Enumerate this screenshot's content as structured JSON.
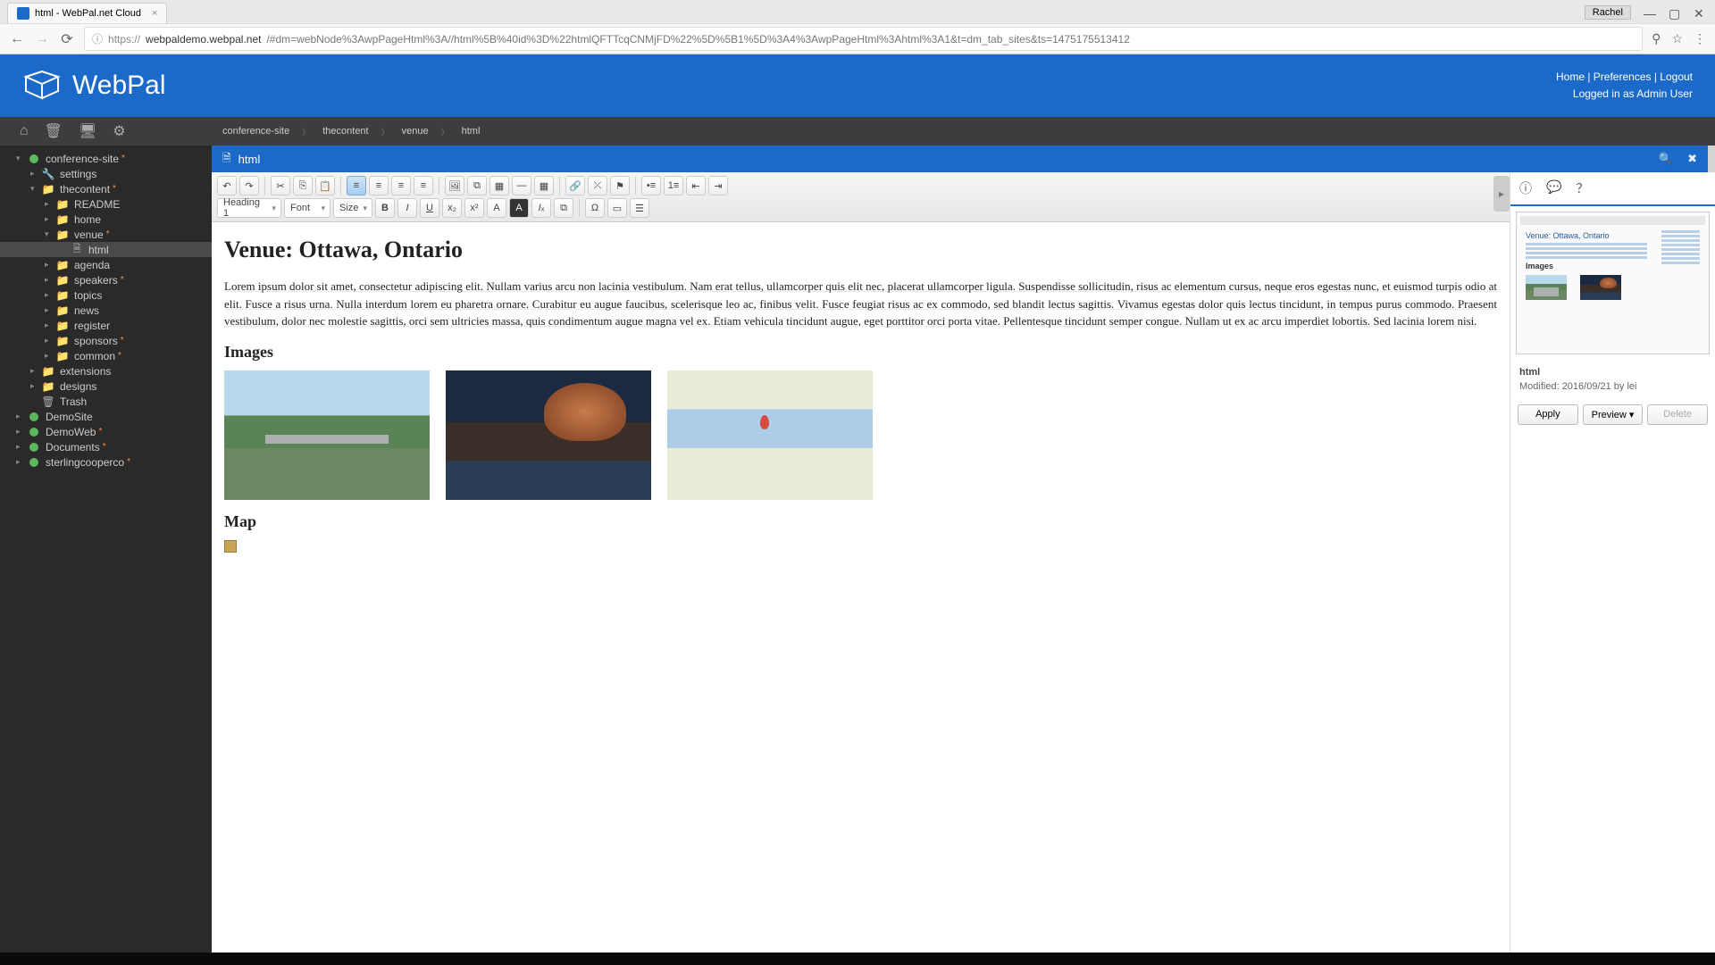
{
  "browser": {
    "tab_title": "html - WebPal.net Cloud",
    "user_chip": "Rachel",
    "url_proto": "https://",
    "url_host": "webpaldemo.webpal.net",
    "url_path": "/#dm=webNode%3AwpPageHtml%3A//html%5B%40id%3D%22htmlQFTTcqCNMjFD%22%5D%5B1%5D%3A4%3AwpPageHtml%3Ahtml%3A1&t=dm_tab_sites&ts=1475175513412"
  },
  "header": {
    "brand": "WebPal",
    "links": {
      "home": "Home",
      "prefs": "Preferences",
      "logout": "Logout"
    },
    "logged_in": "Logged in as Admin User"
  },
  "breadcrumb": [
    "conference-site",
    "thecontent",
    "venue",
    "html"
  ],
  "tree": [
    {
      "lvl": 1,
      "arrow": "▾",
      "icon": "green",
      "label": "conference-site",
      "star": true
    },
    {
      "lvl": 2,
      "arrow": "▸",
      "icon": "wrench",
      "label": "settings"
    },
    {
      "lvl": 2,
      "arrow": "▾",
      "icon": "folder",
      "label": "thecontent",
      "star": true
    },
    {
      "lvl": 3,
      "arrow": "▸",
      "icon": "folder",
      "label": "README"
    },
    {
      "lvl": 3,
      "arrow": "▸",
      "icon": "folder",
      "label": "home"
    },
    {
      "lvl": 3,
      "arrow": "▾",
      "icon": "folder",
      "label": "venue",
      "star": true
    },
    {
      "lvl": 4,
      "arrow": "",
      "icon": "page",
      "label": "html",
      "selected": true
    },
    {
      "lvl": 3,
      "arrow": "▸",
      "icon": "folder",
      "label": "agenda"
    },
    {
      "lvl": 3,
      "arrow": "▸",
      "icon": "folder",
      "label": "speakers",
      "star": true
    },
    {
      "lvl": 3,
      "arrow": "▸",
      "icon": "folder",
      "label": "topics"
    },
    {
      "lvl": 3,
      "arrow": "▸",
      "icon": "folder",
      "label": "news"
    },
    {
      "lvl": 3,
      "arrow": "▸",
      "icon": "folder",
      "label": "register"
    },
    {
      "lvl": 3,
      "arrow": "▸",
      "icon": "folder",
      "label": "sponsors",
      "star": true
    },
    {
      "lvl": 3,
      "arrow": "▸",
      "icon": "folder",
      "label": "common",
      "star": true
    },
    {
      "lvl": 2,
      "arrow": "▸",
      "icon": "folder",
      "label": "extensions"
    },
    {
      "lvl": 2,
      "arrow": "▸",
      "icon": "folder",
      "label": "designs"
    },
    {
      "lvl": 2,
      "arrow": "",
      "icon": "trash",
      "label": "Trash"
    },
    {
      "lvl": 1,
      "arrow": "▸",
      "icon": "green",
      "label": "DemoSite"
    },
    {
      "lvl": 1,
      "arrow": "▸",
      "icon": "green",
      "label": "DemoWeb",
      "star": true
    },
    {
      "lvl": 1,
      "arrow": "▸",
      "icon": "green",
      "label": "Documents",
      "star": true
    },
    {
      "lvl": 1,
      "arrow": "▸",
      "icon": "green",
      "label": "sterlingcooperco",
      "star": true
    }
  ],
  "doc_tab": {
    "title": "html"
  },
  "ck": {
    "heading": "Heading 1",
    "font": "Font",
    "size": "Size"
  },
  "content": {
    "h1": "Venue: Ottawa, Ontario",
    "para": "Lorem ipsum dolor sit amet, consectetur adipiscing elit. Nullam varius arcu non lacinia vestibulum. Nam erat tellus, ullamcorper quis elit nec, placerat ullamcorper ligula. Suspendisse sollicitudin, risus ac elementum cursus, neque eros egestas nunc, et euismod turpis odio at elit. Fusce a risus urna. Nulla interdum lorem eu pharetra ornare. Curabitur eu augue faucibus, scelerisque leo ac, finibus velit. Fusce feugiat risus ac ex commodo, sed blandit lectus sagittis. Vivamus egestas dolor quis lectus tincidunt, in tempus purus commodo. Praesent vestibulum, dolor nec molestie sagittis, orci sem ultricies massa, quis condimentum augue magna vel ex. Etiam vehicula tincidunt augue, eget porttitor orci porta vitae. Pellentesque tincidunt semper congue. Nullam ut ex ac arcu imperdiet lobortis. Sed lacinia lorem nisi.",
    "h2_images": "Images",
    "h2_map": "Map"
  },
  "info": {
    "title": "html",
    "modified": "Modified: 2016/09/21 by lei",
    "preview_heading": "Venue: Ottawa, Ontario",
    "preview_images_label": "Images",
    "apply": "Apply",
    "preview": "Preview ▾",
    "delete": "Delete"
  }
}
